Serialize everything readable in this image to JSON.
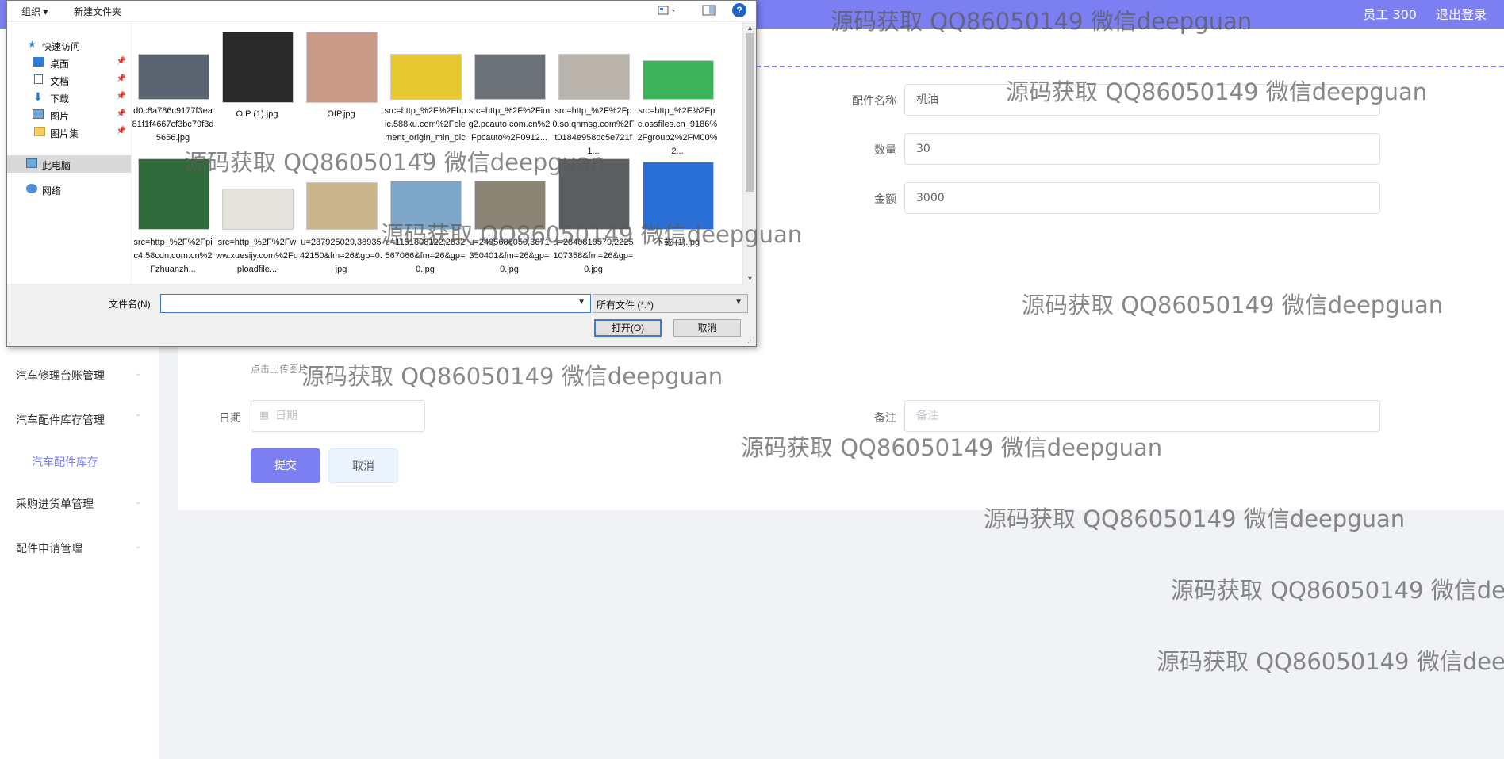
{
  "header": {
    "user_label": "员工 300",
    "logout_label": "退出登录"
  },
  "sidebar": {
    "items": [
      {
        "label": "汽车修理台账管理"
      },
      {
        "label": "汽车配件库存管理"
      },
      {
        "label": "采购进货单管理"
      },
      {
        "label": "配件申请管理"
      }
    ],
    "sub_item": "汽车配件库存"
  },
  "form": {
    "part_name_label": "配件名称",
    "part_name_value": "机油",
    "quantity_label": "数量",
    "quantity_value": "30",
    "amount_label": "金额",
    "amount_value": "3000",
    "upload_hint": "点击上传图片",
    "date_label": "日期",
    "date_placeholder": "日期",
    "remark_label": "备注",
    "remark_placeholder": "备注",
    "submit_label": "提交",
    "cancel_label": "取消"
  },
  "watermark": "源码获取 QQ86050149 微信deepguan",
  "dialog": {
    "toolbar": {
      "organize": "组织 ▾",
      "new_folder": "新建文件夹",
      "help": "?"
    },
    "nav": [
      {
        "label": "快速访问",
        "icon": "star-icon"
      },
      {
        "label": "桌面",
        "icon": "desktop-icon"
      },
      {
        "label": "文档",
        "icon": "document-icon"
      },
      {
        "label": "下载",
        "icon": "download-icon"
      },
      {
        "label": "图片",
        "icon": "picture-icon"
      },
      {
        "label": "图片集",
        "icon": "folder-icon"
      },
      {
        "label": "此电脑",
        "icon": "computer-icon"
      },
      {
        "label": "网络",
        "icon": "network-icon"
      }
    ],
    "files": [
      {
        "name": "d0c8a786c9177f3ea81f1f4667cf3bc79f3d5656.jpg",
        "color": "#5a6470"
      },
      {
        "name": "OIP (1).jpg",
        "color": "#2a2a2a"
      },
      {
        "name": "OIP.jpg",
        "color": "#c99a88"
      },
      {
        "name": "src=http_%2F%2Fbpic.588ku.com%2Felement_origin_min_pic_...",
        "color": "#e8c830"
      },
      {
        "name": "src=http_%2F%2Fimg2.pcauto.com.cn%2Fpcauto%2F0912...",
        "color": "#6d7278"
      },
      {
        "name": "src=http_%2F%2Fp0.so.qhmsg.com%2Ft0184e958dc5e721f1...",
        "color": "#b8b4ac"
      },
      {
        "name": "src=http_%2F%2Fpic.ossfiles.cn_9186%2Fgroup2%2FM00%2...",
        "color": "#3cb35a"
      },
      {
        "name": "src=http_%2F%2Fpic4.58cdn.com.cn%2Fzhuanzh...",
        "color": "#2f6b3a"
      },
      {
        "name": "src=http_%2F%2Fwww.xuesijy.com%2Fuploadfile...",
        "color": "#e6e2dc"
      },
      {
        "name": "u=237925029,3893542150&fm=26&gp=0.jpg",
        "color": "#c9b48c"
      },
      {
        "name": "u=1151808122,2832567066&fm=26&gp=0.jpg",
        "color": "#7ea6c8"
      },
      {
        "name": "u=2495686050,3671350401&fm=26&gp=0.jpg",
        "color": "#8a8474"
      },
      {
        "name": "u=2840819579,2225107358&fm=26&gp=0.jpg",
        "color": "#5b5f62"
      },
      {
        "name": "下载 (1).jpg",
        "color": "#2a6fd6"
      }
    ],
    "filename_label": "文件名(N):",
    "filetype": "所有文件 (*.*)",
    "open_label": "打开(O)",
    "cancel_label": "取消"
  }
}
